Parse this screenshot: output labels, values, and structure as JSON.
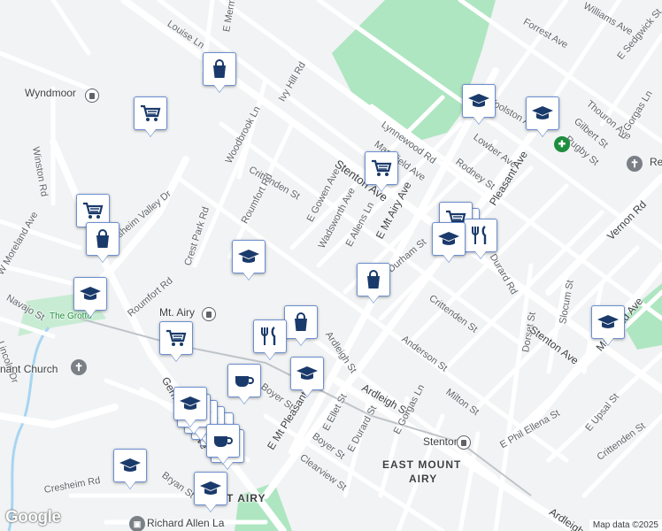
{
  "streets": [
    "Louise Ln",
    "E Mermaid Ln",
    "Ivy Hill Rd",
    "Wyndmoor",
    "Winston Rd",
    "Woodbrook Ln",
    "Crittenden St",
    "Roumfort Rd",
    "E Gowen Ave",
    "Stenton Ave",
    "Wadsworth Ave",
    "E Allens Ln",
    "E Mt Airy Ave",
    "Mansfield Ave",
    "Lynnewood Rd",
    "Rodney St",
    "Lowber Ave",
    "Pleasant Ave",
    "Durham St",
    "Durard Rd",
    "Crittenden St",
    "Anderson St",
    "Ardleigh St",
    "Ardleigh St",
    "Milton St",
    "Boyer St",
    "Boyer St",
    "E Mt Pleasant Ave",
    "E Ellet St",
    "E Durard St",
    "E Gorgas Ln",
    "Clearview St",
    "Bryan St",
    "Cresheim Rd",
    "Cresheim Valley Dr",
    "Crest Park Rd",
    "Roumfort Rd",
    "W Moreland Ave",
    "Navajo St",
    "Lincoln Dr",
    "Germantown Ave",
    "Forrest Ave",
    "E Sedgwick St",
    "Thouron Ave",
    "Gilbert St",
    "Rugby St",
    "E Gorgas Ln",
    "Vernon Rd",
    "Slocum St",
    "Dorset St",
    "Mansfield Ave",
    "Stenton Ave",
    "E Upsal St",
    "Crittenden St",
    "E Phil Ellena St",
    "Ardleigh St",
    "Woolston Ave",
    "Williams Ave"
  ],
  "places": {
    "mt_airy": "Mt. Airy",
    "stenton": "Stenton",
    "east_mount_airy_line1": "EAST MOUNT",
    "east_mount_airy_line2": "AIRY",
    "grotto": "The Grotto",
    "church": "nant Church",
    "richard_allen": "Richard Allen La",
    "airy_partial": "T AIRY",
    "re_lu": "Re Lu"
  },
  "attribution": {
    "logo": "Google",
    "copyright": "Map data ©2025"
  },
  "colors": {
    "background": "#f1f3f4",
    "park": "#aee6c1",
    "road": "#ffffff",
    "pin_border": "#6c8fd1",
    "pin_icon": "#1a3a6b"
  },
  "markers": [
    {
      "icon": "shopping-bag-icon"
    },
    {
      "icon": "shopping-cart-icon"
    },
    {
      "icon": "graduation-cap-icon"
    },
    {
      "icon": "graduation-cap-icon"
    },
    {
      "icon": "shopping-cart-icon"
    },
    {
      "icon": "shopping-cart-icon"
    },
    {
      "icon": "shopping-bag-icon"
    },
    {
      "icon": "graduation-cap-icon"
    },
    {
      "icon": "restaurant-icon"
    },
    {
      "icon": "graduation-cap-icon"
    },
    {
      "icon": "shopping-bag-icon"
    },
    {
      "icon": "graduation-cap-icon"
    },
    {
      "icon": "shopping-bag-icon"
    },
    {
      "icon": "restaurant-icon"
    },
    {
      "icon": "shopping-cart-icon"
    },
    {
      "icon": "graduation-cap-icon"
    },
    {
      "icon": "graduation-cap-icon"
    },
    {
      "icon": "coffee-cup-icon"
    },
    {
      "icon": "coffee-cup-icon"
    },
    {
      "icon": "graduation-cap-icon"
    },
    {
      "icon": "graduation-cap-icon"
    },
    {
      "icon": "graduation-cap-icon"
    }
  ]
}
